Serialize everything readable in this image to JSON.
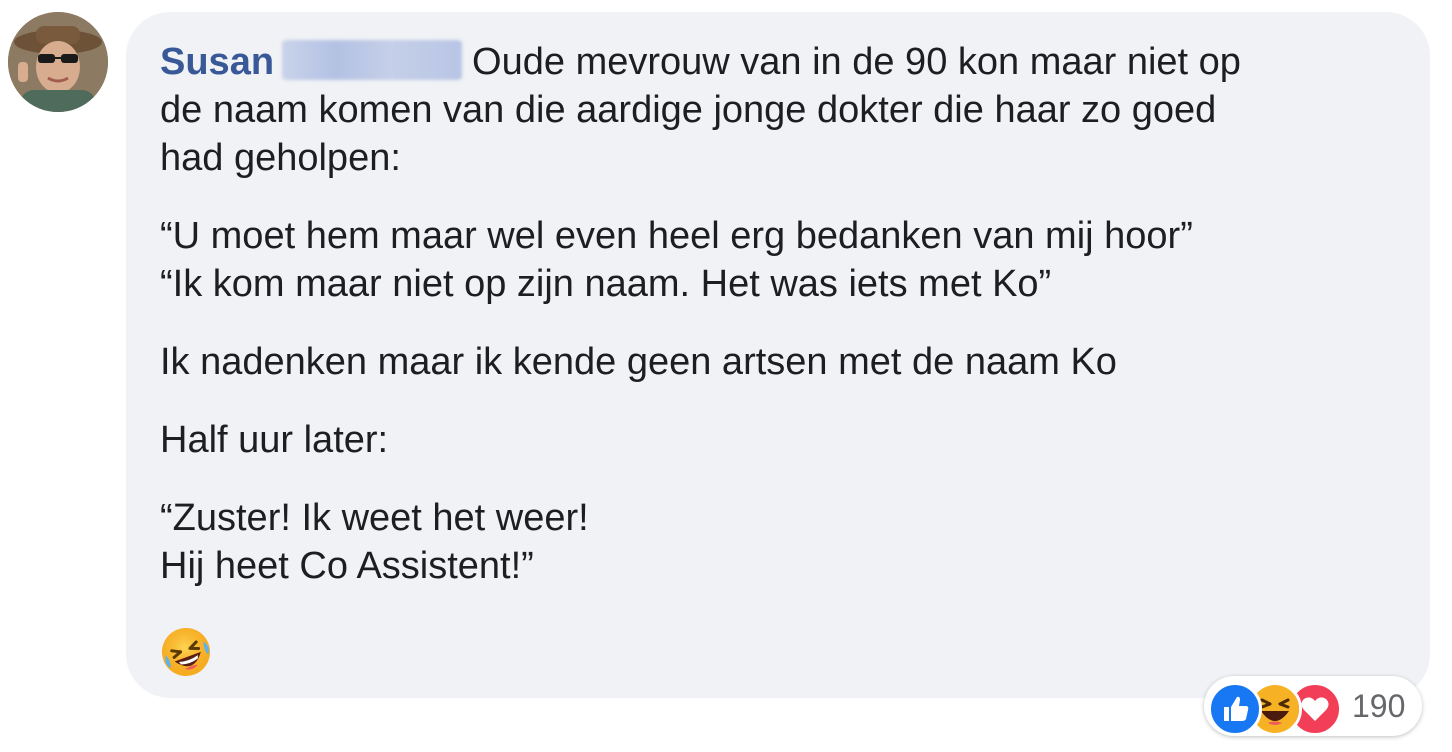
{
  "comment": {
    "author_first_name": "Susan",
    "paragraphs": [
      {
        "lines": [
          "Oude mevrouw van in de 90 kon maar niet op",
          "de naam komen van die aardige jonge dokter die haar zo goed",
          "had geholpen:"
        ]
      },
      {
        "lines": [
          "“U moet hem maar wel even heel erg bedanken van mij hoor”",
          "“Ik kom maar niet op zijn naam. Het was iets met Ko”"
        ]
      },
      {
        "lines": [
          "Ik nadenken maar ik kende geen artsen met de naam Ko"
        ]
      },
      {
        "lines": [
          "Half uur later:"
        ]
      },
      {
        "lines": [
          "“Zuster! Ik weet het weer!",
          "Hij heet Co Assistent!”"
        ]
      }
    ],
    "trailing_emoji": "rolling-on-floor-laughing-emoji"
  },
  "reactions": {
    "icons": [
      "like-icon",
      "haha-icon",
      "love-icon"
    ],
    "count": "190"
  },
  "colors": {
    "bubble_bg": "#f0f2f5",
    "author": "#385898",
    "text": "#1c1e21",
    "like": "#1877f2",
    "love": "#f33e58",
    "haha": "#f7b125"
  }
}
